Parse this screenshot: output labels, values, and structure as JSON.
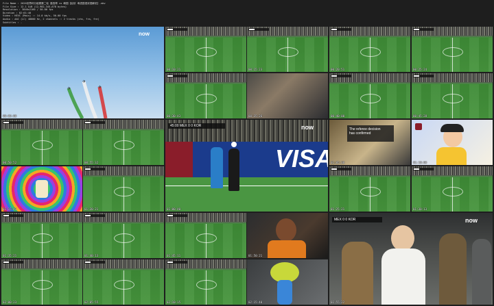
{
  "header": {
    "file_name": "File Name  : 2026世界杯分组赛第二轮 墨西哥 vs 韩国【赵欣 粤语国语双语解说】.mkv",
    "file_size": "File Size  : 12.1 GiB (12,982,345,678 bytes)",
    "resolution": "Resolution : 3840x2160 / 50.00 fps",
    "duration": "Duration   : 02:01:40",
    "video": "Video      : HEVC (Main) :: 14.0 kb/s, 50.00 fps",
    "audio": "Audio      : AAC (LC) 48000 Hz, 2 channels :: 2 tracks (chs, fra, fre)",
    "subtitles": "Subtitles  : -"
  },
  "broadcast": {
    "brand": "now",
    "channel": "4K",
    "score_home": "MEX",
    "score_away": "KOR",
    "clock": "45:00",
    "ad_board": "VISA",
    "replay_msg_1": "The referee decision",
    "replay_msg_2": "has confirmed"
  },
  "thumbs": [
    {
      "ts": "00:05:00"
    },
    {
      "ts": "00:10:21"
    },
    {
      "ts": "00:15:23"
    },
    {
      "ts": "00:20:51"
    },
    {
      "ts": "00:25:24"
    },
    {
      "ts": "00:30:43"
    },
    {
      "ts": "00:35:26"
    },
    {
      "ts": "00:40:00"
    },
    {
      "ts": "00:45:28"
    },
    {
      "ts": "00:50:52"
    },
    {
      "ts": "00:55:32"
    },
    {
      "ts": "01:00:40"
    },
    {
      "ts": "01:05:38"
    },
    {
      "ts": "01:10:00"
    },
    {
      "ts": "01:15:41"
    },
    {
      "ts": "01:20:21"
    },
    {
      "ts": "01:25:21"
    },
    {
      "ts": "01:30:13"
    },
    {
      "ts": "01:35:21"
    },
    {
      "ts": "01:40:13"
    },
    {
      "ts": "01:45:11"
    },
    {
      "ts": "01:50:21"
    },
    {
      "ts": "01:55:22"
    },
    {
      "ts": "02:00:23"
    },
    {
      "ts": "02:05:55"
    },
    {
      "ts": "02:10:15"
    },
    {
      "ts": "02:15:40"
    },
    {
      "ts": "02:20:40"
    }
  ]
}
